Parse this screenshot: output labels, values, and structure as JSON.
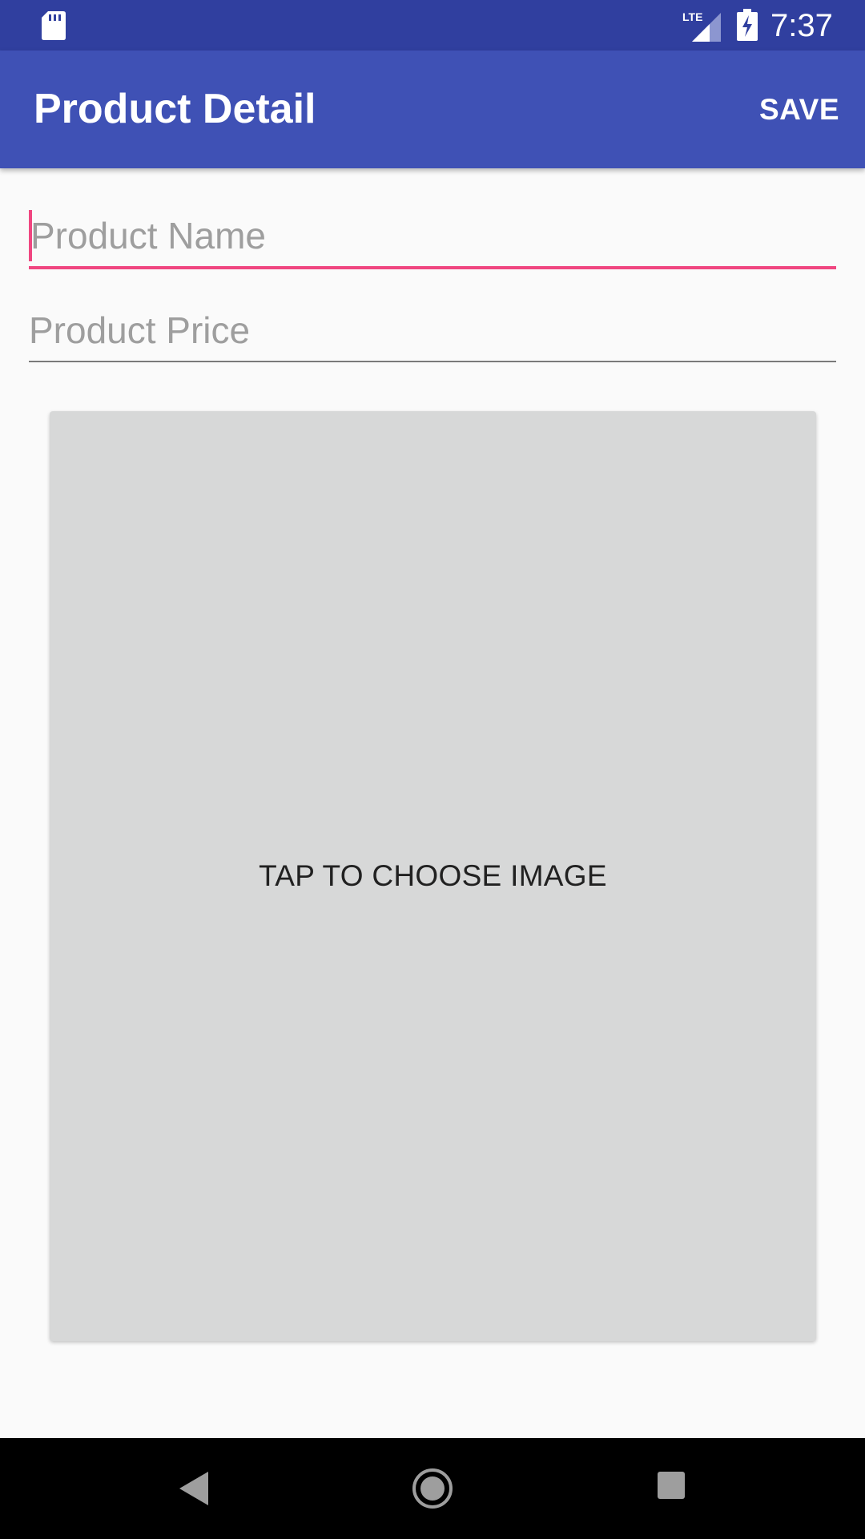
{
  "status_bar": {
    "time": "7:37",
    "network": "LTE",
    "icons": [
      "sd-card-icon",
      "signal-icon",
      "battery-charging-icon"
    ]
  },
  "app_bar": {
    "title": "Product Detail",
    "save_label": "SAVE"
  },
  "form": {
    "product_name": {
      "value": "",
      "placeholder": "Product Name"
    },
    "product_price": {
      "value": "",
      "placeholder": "Product Price"
    }
  },
  "image_picker": {
    "label": "TAP TO CHOOSE IMAGE"
  },
  "nav_bar": {
    "icons": [
      "back-icon",
      "home-icon",
      "recents-icon"
    ]
  },
  "colors": {
    "status_bar": "#303f9f",
    "app_bar": "#3f51b5",
    "accent": "#f04680",
    "image_placeholder": "#d7d8d8",
    "background": "#fafafa"
  }
}
